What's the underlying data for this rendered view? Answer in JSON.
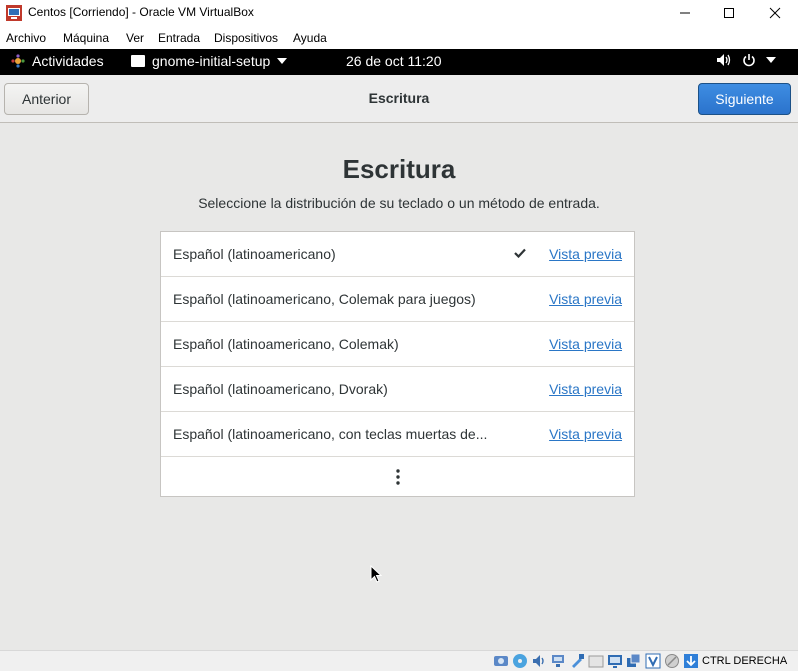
{
  "window": {
    "title": "Centos [Corriendo] - Oracle VM VirtualBox",
    "minimize_label": "",
    "maximize_label": "",
    "close_label": ""
  },
  "menu": {
    "items": [
      "Archivo",
      "Máquina",
      "Ver",
      "Entrada",
      "Dispositivos",
      "Ayuda"
    ]
  },
  "gnome_bar": {
    "activities": "Actividades",
    "app_name": "gnome-initial-setup",
    "clock": "26 de oct  11:20"
  },
  "header": {
    "back_label": "Anterior",
    "title": "Escritura",
    "next_label": "Siguiente"
  },
  "main": {
    "title": "Escritura",
    "subtitle": "Seleccione la distribución de su teclado o un método de entrada.",
    "preview_label": "Vista previa",
    "layouts": [
      {
        "label": "Español (latinoamericano)",
        "selected": true
      },
      {
        "label": "Español (latinoamericano, Colemak para juegos)",
        "selected": false
      },
      {
        "label": "Español (latinoamericano, Colemak)",
        "selected": false
      },
      {
        "label": "Español (latinoamericano, Dvorak)",
        "selected": false
      },
      {
        "label": "Español (latinoamericano, con teclas muertas de...",
        "selected": false
      }
    ]
  },
  "statusbar": {
    "host_key": "CTRL DERECHA",
    "icons": [
      "hard-disk-icon",
      "optical-drive-icon",
      "audio-icon",
      "network-icon",
      "usb-icon",
      "shared-folders-icon",
      "display-icon",
      "video-capture-icon",
      "virtualization-icon",
      "mouse-integration-icon",
      "host-key-icon"
    ]
  },
  "colors": {
    "accent": "#2b73cc",
    "link": "#2a76c6",
    "gnome_bar": "#000000",
    "content_bg": "#e8e8e7"
  }
}
